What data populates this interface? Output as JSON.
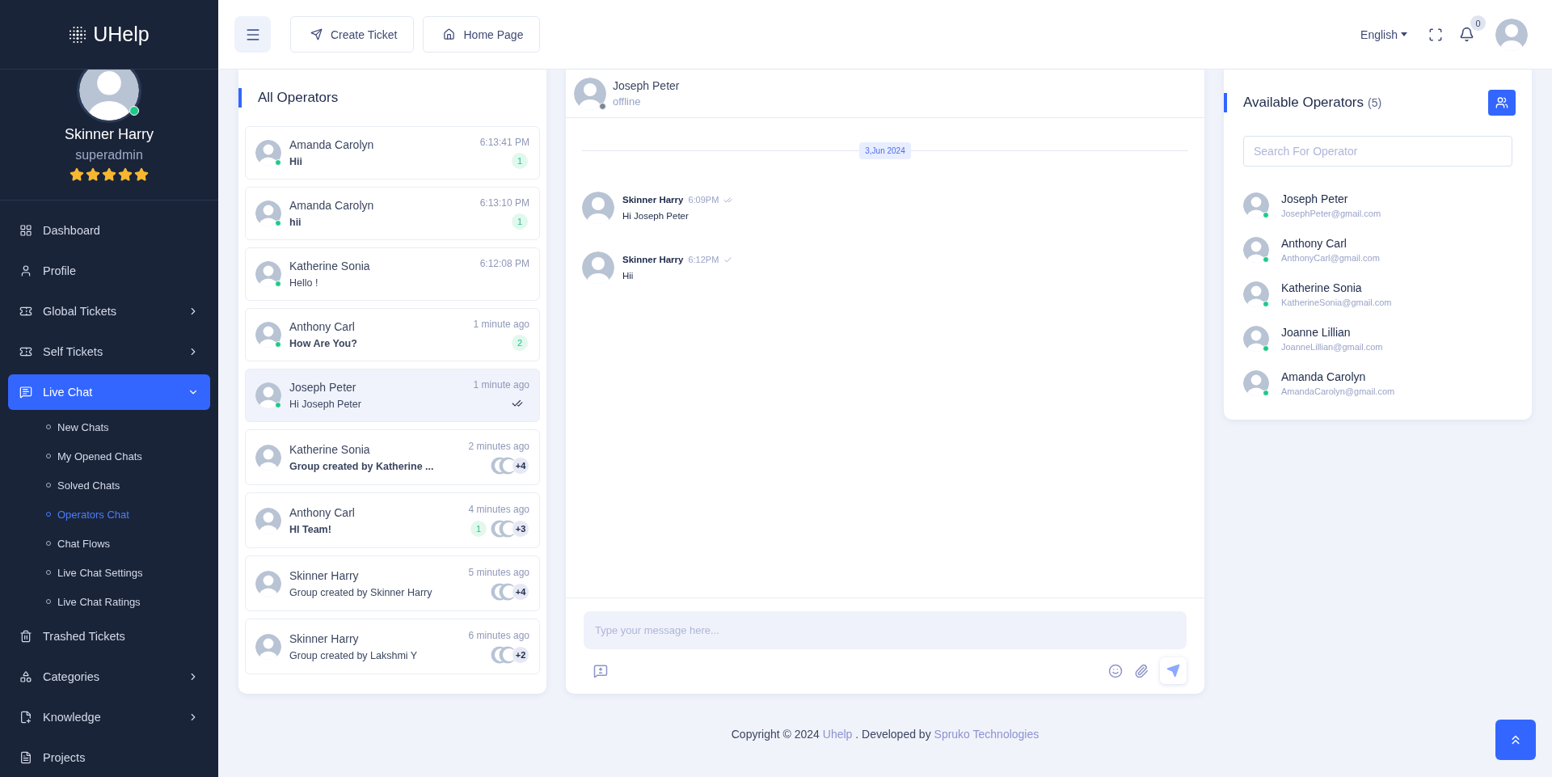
{
  "brand": "UHelp",
  "profile": {
    "name": "Skinner Harry",
    "role": "superadmin",
    "online": true,
    "stars": 5
  },
  "menu": [
    {
      "label": "Dashboard",
      "has_submenu": false,
      "expanded": false,
      "selected": false
    },
    {
      "label": "Profile",
      "has_submenu": false,
      "expanded": false,
      "selected": false
    },
    {
      "label": "Global Tickets",
      "has_submenu": true,
      "expanded": false,
      "selected": false
    },
    {
      "label": "Self Tickets",
      "has_submenu": true,
      "expanded": false,
      "selected": false
    },
    {
      "label": "Live Chat",
      "has_submenu": true,
      "expanded": true,
      "selected": true,
      "children": [
        {
          "label": "New Chats",
          "selected": false
        },
        {
          "label": "My Opened Chats",
          "selected": false
        },
        {
          "label": "Solved Chats",
          "selected": false
        },
        {
          "label": "Operators Chat",
          "selected": true
        },
        {
          "label": "Chat Flows",
          "selected": false
        },
        {
          "label": "Live Chat Settings",
          "selected": false
        },
        {
          "label": "Live Chat Ratings",
          "selected": false
        }
      ]
    },
    {
      "label": "Trashed Tickets",
      "has_submenu": false,
      "expanded": false,
      "selected": false
    },
    {
      "label": "Categories",
      "has_submenu": true,
      "expanded": false,
      "selected": false
    },
    {
      "label": "Knowledge",
      "has_submenu": true,
      "expanded": false,
      "selected": false
    },
    {
      "label": "Projects",
      "has_submenu": false,
      "expanded": false,
      "selected": false
    }
  ],
  "header": {
    "buttons": [
      "Create Ticket",
      "Home Page"
    ],
    "language": "English",
    "notification_count": "0"
  },
  "all_operators": {
    "title": "All Operators",
    "chats": [
      {
        "kind": "direct",
        "name": "Amanda Carolyn",
        "time": "6:13:41 PM",
        "message": "Hii",
        "online": true,
        "unread": true,
        "badge": "1",
        "read_receipt": false,
        "selected": false
      },
      {
        "kind": "direct",
        "name": "Amanda Carolyn",
        "time": "6:13:10 PM",
        "message": "hii",
        "online": true,
        "unread": true,
        "badge": "1",
        "read_receipt": false,
        "selected": false
      },
      {
        "kind": "direct",
        "name": "Katherine Sonia",
        "time": "6:12:08 PM",
        "message": "Hello !",
        "online": true,
        "unread": false,
        "read_receipt": false,
        "selected": false
      },
      {
        "kind": "direct",
        "name": "Anthony Carl",
        "time": "1 minute ago",
        "message": "How Are You?",
        "online": true,
        "unread": true,
        "badge": "2",
        "read_receipt": false,
        "selected": false
      },
      {
        "kind": "direct",
        "name": "Joseph Peter",
        "time": "1 minute ago",
        "message": "Hi Joseph Peter",
        "online": true,
        "unread": false,
        "read_receipt": true,
        "selected": true
      },
      {
        "kind": "group",
        "name": "Katherine Sonia",
        "time": "2 minutes ago",
        "message": "Group created by Katherine ...",
        "online": false,
        "unread": true,
        "extra_members": "+4",
        "read_receipt": false,
        "selected": false
      },
      {
        "kind": "group",
        "name": "Anthony Carl",
        "time": "4 minutes ago",
        "message": "HI Team!",
        "online": false,
        "unread": true,
        "badge": "1",
        "extra_members": "+3",
        "read_receipt": false,
        "selected": false
      },
      {
        "kind": "group",
        "name": "Skinner Harry",
        "time": "5 minutes ago",
        "message": "Group created by Skinner Harry",
        "online": false,
        "unread": false,
        "extra_members": "+4",
        "read_receipt": false,
        "selected": false
      },
      {
        "kind": "group",
        "name": "Skinner Harry",
        "time": "6 minutes ago",
        "message": "Group created by Lakshmi Y",
        "online": false,
        "unread": false,
        "extra_members": "+2",
        "read_receipt": false,
        "selected": false
      }
    ]
  },
  "chat": {
    "name": "Joseph Peter",
    "status": "offline",
    "online": false,
    "date": "3,Jun 2024",
    "messages": [
      {
        "sender": "Skinner Harry",
        "time": "6:09PM",
        "text": "Hi Joseph Peter",
        "read": true
      },
      {
        "sender": "Skinner Harry",
        "time": "6:12PM",
        "text": "Hii",
        "read": false
      }
    ],
    "placeholder": "Type your message here..."
  },
  "available_operators": {
    "title": "Available Operators",
    "count": "(5)",
    "search_placeholder": "Search For Operator",
    "operators": [
      {
        "name": "Joseph Peter",
        "email": "JosephPeter@gmail.com",
        "online": true
      },
      {
        "name": "Anthony Carl",
        "email": "AnthonyCarl@gmail.com",
        "online": true
      },
      {
        "name": "Katherine Sonia",
        "email": "KatherineSonia@gmail.com",
        "online": true
      },
      {
        "name": "Joanne Lillian",
        "email": "JoanneLillian@gmail.com",
        "online": true
      },
      {
        "name": "Amanda Carolyn",
        "email": "AmandaCarolyn@gmail.com",
        "online": true
      }
    ]
  },
  "footer": {
    "before": "Copyright © 2024 ",
    "brand_link": "Uhelp",
    "middle": " . Developed by ",
    "company_link": "Spruko Technologies"
  }
}
